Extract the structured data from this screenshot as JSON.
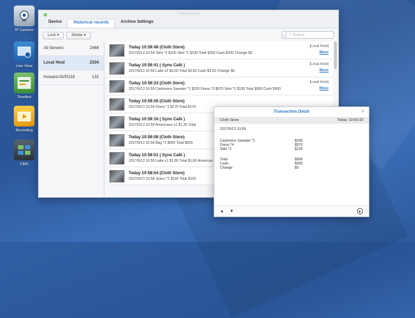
{
  "desktop": {
    "icons": [
      {
        "label": "IP Camera",
        "icon": "ip-camera-icon"
      },
      {
        "label": "Live View",
        "icon": "live-view-icon"
      },
      {
        "label": "Timeline",
        "icon": "timeline-icon"
      },
      {
        "label": "Recording",
        "icon": "recording-icon"
      },
      {
        "label": "CMS",
        "icon": "cms-icon"
      }
    ]
  },
  "window": {
    "title": "Transactions",
    "tabs": [
      "Device",
      "Historical records",
      "Archive Settings"
    ],
    "toolbar": {
      "lock": "Lock",
      "delete": "Delete",
      "search_placeholder": "Search"
    }
  },
  "sidebar": {
    "items": [
      {
        "label": "All Servers",
        "count": "2466"
      },
      {
        "label": "Local Host",
        "count": "2334"
      },
      {
        "label": "Howard-NVR216",
        "count": "132"
      }
    ]
  },
  "records": [
    {
      "header": "Today 10:59:48 (Cloth Store)",
      "line": "2017/6/13   10:59   Shirt *1  $100  Skirt *1  $100  Total  $200  Cash  $200  Change  $0",
      "source": "[Local Host]",
      "more": "More"
    },
    {
      "header": "Today 10:59:41 ( Syno Café )",
      "line": "2017/6/13   10:59   Latte x2  $3.60  Total  $3.60  Cash  $3.60  Change  $0",
      "source": "[Local Host]",
      "more": "More"
    },
    {
      "header": "Today 10:59:33 (Cloth Store)",
      "line": "2017/6/13   10:59   Cashmere Sweater *1  $200  Dress *3  $570  Skirt *1  $130  Total  $900  Cash  $900",
      "source": "[Local Host]",
      "more": "More"
    },
    {
      "header": "Today 10:59:26 (Cloth Store)",
      "line": "2017/6/13   10:59   Dress *1  $170  Total  $170",
      "source": "",
      "more": ""
    },
    {
      "header": "Today 10:59:16 ( Syno Café )",
      "line": "2017/6/13   10:59   Americano x1  $1.35  Total",
      "source": "",
      "more": ""
    },
    {
      "header": "Today 10:59:08 (Cloth Store)",
      "line": "2017/6/13   10:59   Bag *1  $600  Total  $600",
      "source": "",
      "more": ""
    },
    {
      "header": "Today 10:59:01 ( Syno Café )",
      "line": "2017/6/13   10:59   Latte x1  $1.80  Total  $1.80  American",
      "source": "",
      "more": ""
    },
    {
      "header": "Today 10:58:54 (Cloth Store)",
      "line": "2017/6/13   10:58   Jeans *1  $120  Total  $120",
      "source": "",
      "more": ""
    }
  ],
  "detail": {
    "title": "Transaction Detail",
    "store": "Cloth Store",
    "time": "Today 10:59:33",
    "date_line": "2017/6/13     10:59",
    "items": [
      {
        "k": "Cashmere Sweater *1",
        "v": "$200"
      },
      {
        "k": "Dress *4",
        "v": "$570"
      },
      {
        "k": "Skirt *1",
        "v": "$130"
      }
    ],
    "totals": [
      {
        "k": "Total",
        "v": "$900"
      },
      {
        "k": "Cash",
        "v": "$900"
      },
      {
        "k": "Change",
        "v": "$0"
      }
    ]
  }
}
